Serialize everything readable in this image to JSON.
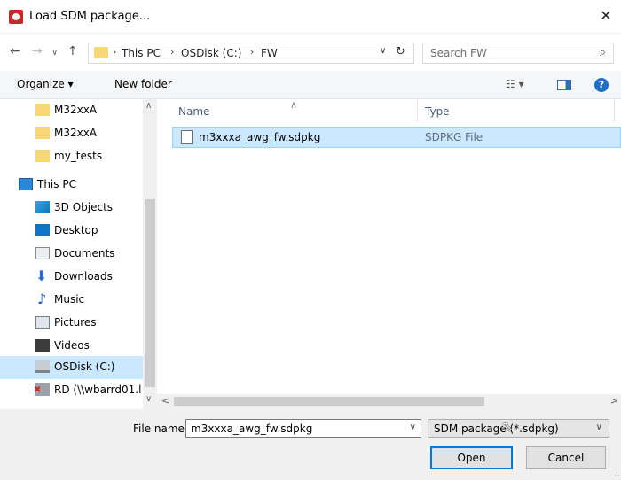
{
  "window": {
    "title": "Load SDM package...",
    "close_glyph": "✕"
  },
  "navigation": {
    "back_glyph": "←",
    "forward_glyph": "→",
    "recent_glyph": "∨",
    "up_glyph": "↑"
  },
  "address": {
    "sep1": "›",
    "crumbs": [
      "This PC",
      "OSDisk (C:)",
      "FW"
    ],
    "chevron": "›",
    "dropdown_glyph": "∨",
    "refresh_glyph": "↻"
  },
  "search": {
    "placeholder": "Search FW",
    "icon_glyph": "⌕"
  },
  "toolbar": {
    "organize_label": "Organize ▾",
    "new_folder_label": "New folder",
    "view_glyph": "☷ ▾",
    "help_glyph": "?"
  },
  "nav_pane": {
    "items": [
      {
        "label": "M32xxA",
        "icon": "folder-icon"
      },
      {
        "label": "M32xxA",
        "icon": "folder-icon"
      },
      {
        "label": "my_tests",
        "icon": "folder-icon"
      },
      {
        "label": "This PC",
        "icon": "computer-icon"
      },
      {
        "label": "3D Objects",
        "icon": "3d-objects-icon"
      },
      {
        "label": "Desktop",
        "icon": "desktop-icon"
      },
      {
        "label": "Documents",
        "icon": "documents-icon"
      },
      {
        "label": "Downloads",
        "icon": "downloads-icon"
      },
      {
        "label": "Music",
        "icon": "music-icon"
      },
      {
        "label": "Pictures",
        "icon": "pictures-icon"
      },
      {
        "label": "Videos",
        "icon": "videos-icon"
      },
      {
        "label": "OSDisk (C:)",
        "icon": "disk-icon",
        "selected": true
      },
      {
        "label": "RD (\\\\wbarrd01.l",
        "icon": "network-drive-icon"
      }
    ],
    "scroll_up_glyph": "∧",
    "scroll_down_glyph": "∨"
  },
  "file_list": {
    "columns": [
      "Name",
      "Type"
    ],
    "sort_glyph": "∧",
    "rows": [
      {
        "name": "m3xxxa_awg_fw.sdpkg",
        "type": "SDPKG File"
      }
    ],
    "scroll_left_glyph": "<",
    "scroll_right_glyph": ">"
  },
  "bottom": {
    "file_name_label": "File name:",
    "file_name_value": "m3xxxa_awg_fw.sdpkg",
    "dropdown_glyph": "∨",
    "filter_value": "SDM package (*.sdpkg)",
    "open_label": "Open",
    "cancel_label": "Cancel",
    "cursor_glyph": "⇖"
  },
  "colors": {
    "selection": "#cce8ff",
    "selection_border": "#99d1ff",
    "accent": "#0078d7",
    "bottom_bg": "#f0f0f0"
  }
}
